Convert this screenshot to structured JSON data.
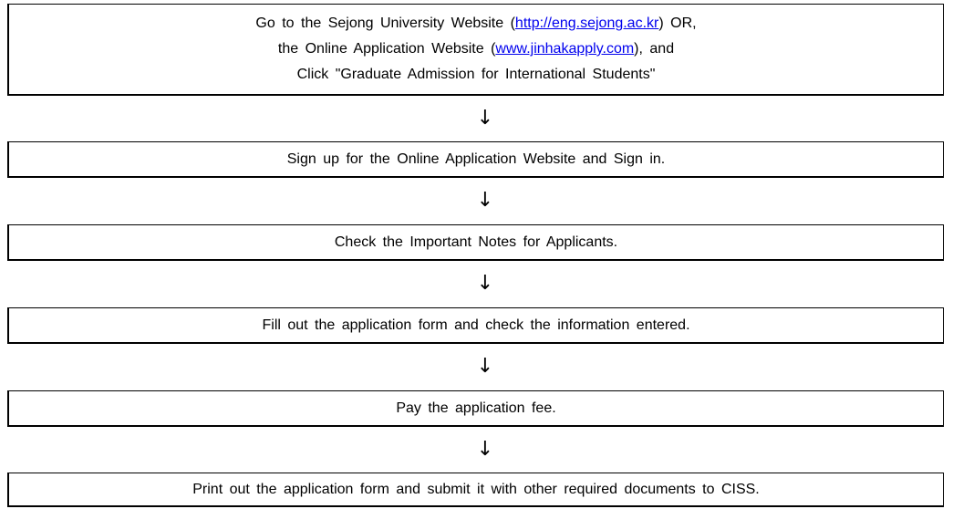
{
  "steps": [
    {
      "line1_pre": "Go to the Sejong University Website (",
      "line1_link": "http://eng.sejong.ac.kr",
      "line1_post": ") OR,",
      "line2_pre": "the Online Application Website (",
      "line2_link": "www.jinhakapply.com",
      "line2_post": "), and",
      "line3": "Click \"Graduate Admission for International Students\""
    },
    {
      "text": "Sign up for the Online Application Website and Sign in."
    },
    {
      "text": "Check the Important Notes for Applicants."
    },
    {
      "text": "Fill out the application form and check the information entered."
    },
    {
      "text": "Pay the application fee."
    },
    {
      "text": "Print out the application form and submit it with other required documents to CISS."
    }
  ],
  "arrow_glyph": "↓"
}
